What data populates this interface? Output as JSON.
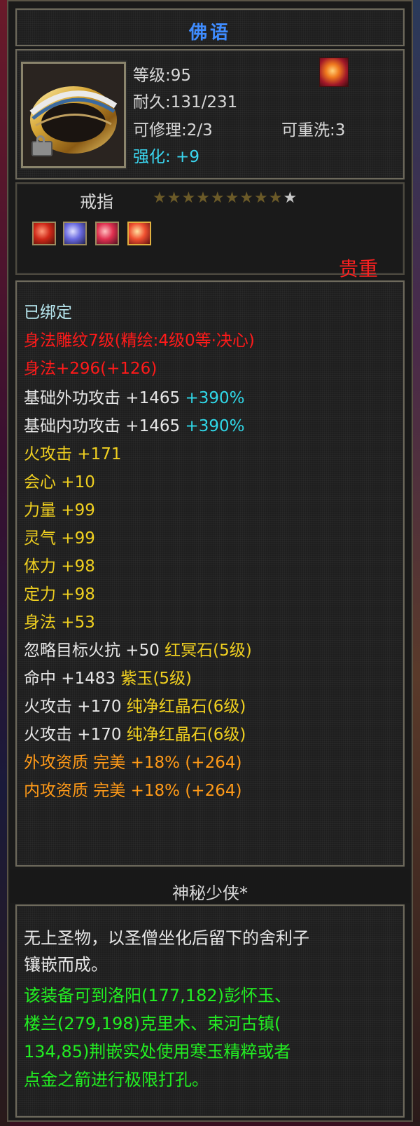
{
  "item": {
    "name": "佛语",
    "level": "等级:95",
    "durability": "耐久:131/231",
    "repair": "可修理:2/3",
    "rewash": "可重洗:3",
    "enhance": "强化: +9",
    "type": "戒指",
    "star_count_filled": 9,
    "stars": "★★★★★★★★★",
    "star_dim": "★",
    "rarity": "贵重"
  },
  "attributes": {
    "bound": "已绑定",
    "engrave": "身法雕纹7级(精绘:4级0等·决心)",
    "agility_bonus": "身法+296(+126)",
    "base_ext_attack": {
      "label": "基础外功攻击 +1465 ",
      "pct": "+390%"
    },
    "base_int_attack": {
      "label": "基础内功攻击 +1465 ",
      "pct": "+390%"
    },
    "stats": [
      "火攻击 +171",
      "会心 +10",
      "力量 +99",
      "灵气 +99",
      "体力 +98",
      "定力 +98",
      "身法 +53"
    ],
    "gem_lines": [
      {
        "label": "忽略目标火抗 +50 ",
        "gem": "红冥石(5级)"
      },
      {
        "label": "命中 +1483 ",
        "gem": "紫玉(5级)"
      },
      {
        "label": "火攻击 +170 ",
        "gem": "纯净红晶石(6级)"
      },
      {
        "label": "火攻击 +170 ",
        "gem": "纯净红晶石(6级)"
      }
    ],
    "aptitude": [
      "外攻资质  完美 +18% (+264)",
      "内攻资质  完美 +18% (+264)"
    ]
  },
  "owner": "神秘少侠*",
  "description": {
    "white_lines": [
      "无上圣物，以圣僧坐化后留下的舍利子",
      "镶嵌而成。"
    ],
    "green_lines": [
      "该装备可到洛阳(177,182)彭怀玉、",
      "楼兰(279,198)克里木、束河古镇(",
      "134,85)荆嵌实处使用寒玉精粹或者",
      "点金之箭进行极限打孔。"
    ]
  },
  "colors": {
    "title": "#3f8cff",
    "red": "#ff1a1a",
    "yellow": "#f0d020",
    "orange": "#ff9a18",
    "cyan": "#30d8e8",
    "green": "#22ee22"
  },
  "icons": [
    "ring-item-icon",
    "lock-icon",
    "flame-badge-icon",
    "red-gem-icon",
    "purple-gem-icon",
    "red-crystal-icon",
    "red-crystal-icon"
  ]
}
